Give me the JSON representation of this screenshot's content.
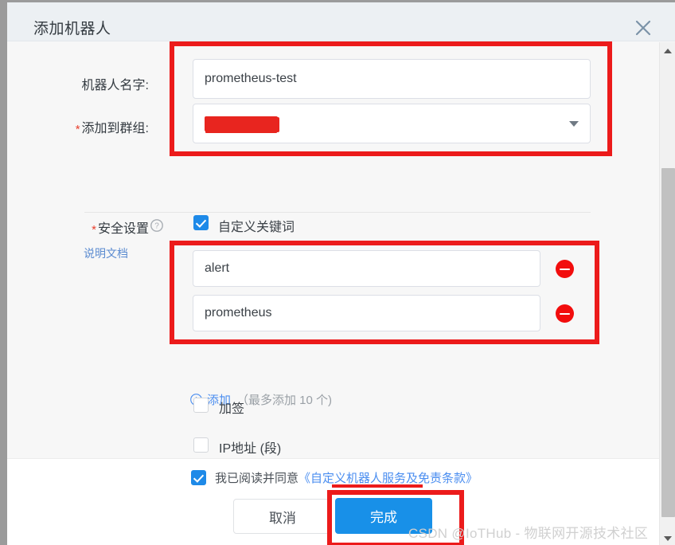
{
  "dialog": {
    "title": "添加机器人",
    "close_icon": "close-icon"
  },
  "form": {
    "robot_name": {
      "label": "机器人名字:",
      "value": "prometheus-test",
      "placeholder": ""
    },
    "group": {
      "label": "添加到群组:",
      "required_mark": "*",
      "value": "",
      "redacted": true,
      "caret_icon": "chevron-down-icon"
    }
  },
  "security": {
    "label": "安全设置",
    "required_mark": "*",
    "help_icon": "question-circle-icon",
    "doc_link": "说明文档",
    "options": [
      {
        "label": "自定义关键词",
        "checked": true
      },
      {
        "label": "加签",
        "checked": false
      },
      {
        "label": "IP地址 (段)",
        "checked": false
      }
    ],
    "keywords": [
      {
        "value": "alert",
        "remove_icon": "minus-circle-icon"
      },
      {
        "value": "prometheus",
        "remove_icon": "minus-circle-icon"
      }
    ],
    "add": {
      "icon": "plus-circle-icon",
      "label": "添加",
      "hint": "（最多添加 10 个)"
    }
  },
  "footer": {
    "agreement": {
      "checked": true,
      "text": "我已阅读并同意",
      "link": "《自定义机器人服务及免责条款》"
    },
    "cancel_label": "取消",
    "confirm_label": "完成"
  },
  "watermark": "CSDN @IoTHub - 物联网开源技术社区",
  "colors": {
    "primary": "#1890e8",
    "link": "#4b8ef0",
    "danger": "#f20d0d",
    "annotation": "#ec1b1b",
    "required": "#e8402e"
  }
}
